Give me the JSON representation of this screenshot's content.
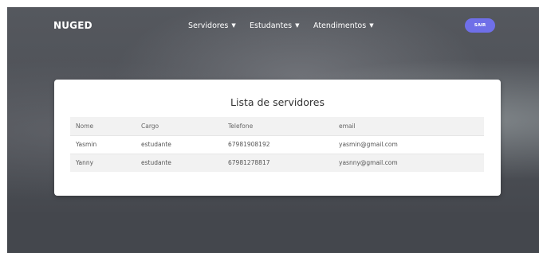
{
  "navbar": {
    "brand": "NUGED",
    "menus": [
      {
        "label": "Servidores"
      },
      {
        "label": "Estudantes"
      },
      {
        "label": "Atendimentos"
      }
    ],
    "logout_label": "SAIR",
    "logout_color": "#6f6fe8"
  },
  "card": {
    "title": "Lista de servidores",
    "columns": [
      "Nome",
      "Cargo",
      "Telefone",
      "email"
    ],
    "rows": [
      [
        "Yasmin",
        "estudante",
        "67981908192",
        "yasmin@gmail.com"
      ],
      [
        "Yanny",
        "estudante",
        "67981278817",
        "yasnny@gmail.com"
      ]
    ]
  }
}
